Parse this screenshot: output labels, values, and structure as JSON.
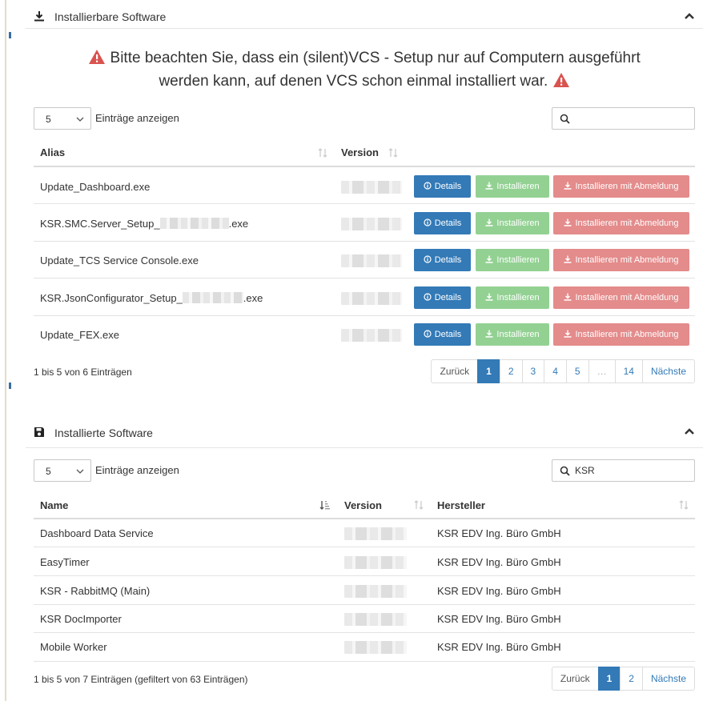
{
  "installable": {
    "title": "Installierbare Software",
    "warning_line1": "Bitte beachten Sie, dass ein (silent)VCS - Setup nur auf Computern ausgeführt",
    "warning_line2": "werden kann, auf denen VCS schon einmal installiert war.",
    "length_value": "5",
    "length_label": "Einträge anzeigen",
    "search_value": "",
    "columns": [
      "Alias",
      "Version"
    ],
    "rows": [
      {
        "alias": "Update_Dashboard.exe"
      },
      {
        "alias_prefix": "KSR.SMC.Server_Setup_",
        "alias_suffix": ".exe"
      },
      {
        "alias": "Update_TCS Service Console.exe"
      },
      {
        "alias_prefix": "KSR.JsonConfigurator_Setup_",
        "alias_suffix": ".exe"
      },
      {
        "alias": "Update_FEX.exe"
      }
    ],
    "btn_details": "Details",
    "btn_install": "Installieren",
    "btn_install_logout": "Installieren mit Abmeldung",
    "info": "1 bis 5 von 6 Einträgen",
    "pagination": [
      "Zurück",
      "1",
      "2",
      "3",
      "4",
      "5",
      "…",
      "14",
      "Nächste"
    ],
    "active_page": "1"
  },
  "installed": {
    "title": "Installierte Software",
    "length_value": "5",
    "length_label": "Einträge anzeigen",
    "search_value": "KSR",
    "columns": [
      "Name",
      "Version",
      "Hersteller"
    ],
    "rows": [
      {
        "name": "Dashboard Data Service",
        "vendor": "KSR EDV Ing. Büro GmbH"
      },
      {
        "name": "EasyTimer",
        "vendor": "KSR EDV Ing. Büro GmbH"
      },
      {
        "name": "KSR - RabbitMQ (Main)",
        "vendor": "KSR EDV Ing. Büro GmbH"
      },
      {
        "name": "KSR DocImporter",
        "vendor": "KSR EDV Ing. Büro GmbH"
      },
      {
        "name": "Mobile Worker",
        "vendor": "KSR EDV Ing. Büro GmbH"
      }
    ],
    "info": "1 bis 5 von 7 Einträgen (gefiltert von 63 Einträgen)",
    "pagination": [
      "Zurück",
      "1",
      "2",
      "Nächste"
    ],
    "active_page": "1"
  },
  "colors": {
    "primary": "#337ab7",
    "success": "#93d193",
    "danger": "#e48b8b",
    "warning_icon": "#d9534f"
  },
  "icons": {
    "download": "download-icon",
    "save": "floppy-disk-icon",
    "collapse": "chevron-up-icon",
    "warning": "warning-triangle-icon",
    "search": "search-icon",
    "info": "info-circle-icon",
    "sort": "sort-icon"
  }
}
